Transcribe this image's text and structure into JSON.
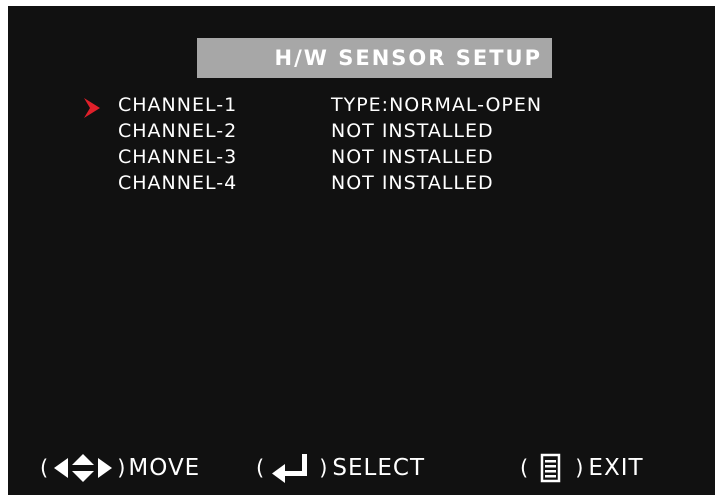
{
  "title": "H/W  SENSOR SETUP",
  "channels": [
    {
      "label": "CHANNEL-1",
      "value": "TYPE:NORMAL-OPEN",
      "selected": true
    },
    {
      "label": "CHANNEL-2",
      "value": "NOT INSTALLED",
      "selected": false
    },
    {
      "label": "CHANNEL-3",
      "value": "NOT INSTALLED",
      "selected": false
    },
    {
      "label": "CHANNEL-4",
      "value": "NOT INSTALLED",
      "selected": false
    }
  ],
  "footer": {
    "move": {
      "open": "(",
      "close": ")",
      "label": "MOVE",
      "icon": "four-way-arrows-icon"
    },
    "select": {
      "open": "(",
      "close": ")",
      "label": "SELECT",
      "icon": "enter-icon"
    },
    "exit": {
      "open": "(",
      "close": ")",
      "label": "EXIT",
      "icon": "menu-icon"
    }
  },
  "colors": {
    "screen_background": "#111111",
    "title_bar": "#a7a7a7",
    "text": "#ffffff",
    "cursor": "#e0202a"
  }
}
